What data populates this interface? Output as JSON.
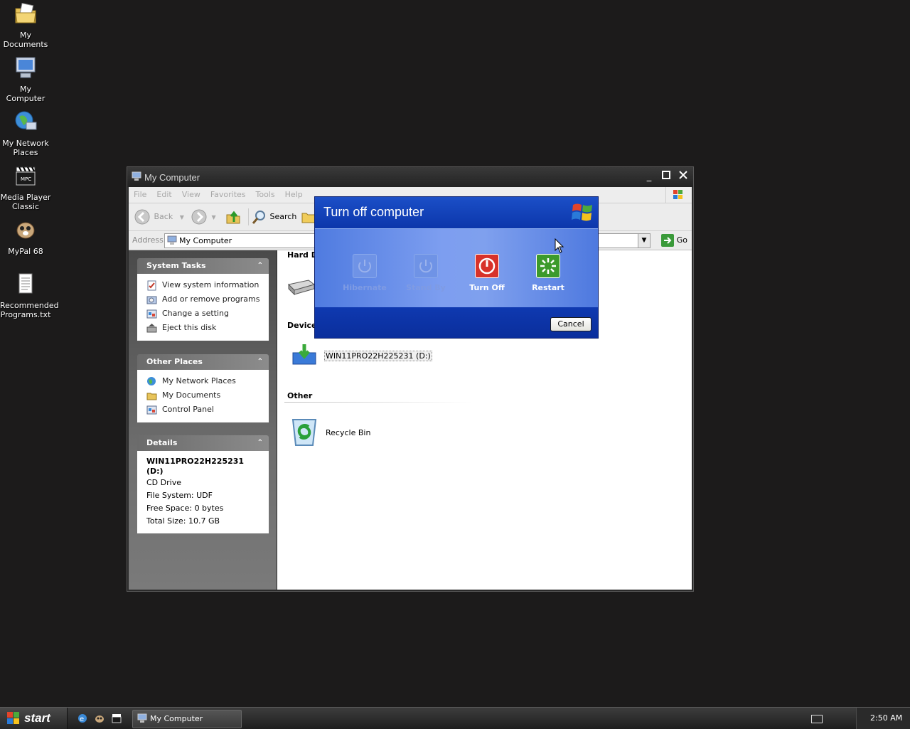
{
  "desktop": {
    "icons": [
      {
        "label": "My Documents",
        "icon": "folder-documents-icon"
      },
      {
        "label": "My Computer",
        "icon": "computer-icon"
      },
      {
        "label": "My Network Places",
        "icon": "network-icon"
      },
      {
        "label": "Media Player Classic",
        "icon": "clapperboard-icon"
      },
      {
        "label": "MyPal 68",
        "icon": "mypal-icon"
      },
      {
        "label": "Recommended Programs.txt",
        "icon": "text-file-icon"
      }
    ]
  },
  "window": {
    "title": "My Computer",
    "menu": [
      "File",
      "Edit",
      "View",
      "Favorites",
      "Tools",
      "Help"
    ],
    "toolbar": {
      "back": "Back",
      "search": "Search"
    },
    "address": {
      "label": "Address",
      "value": "My Computer",
      "go": "Go"
    },
    "system_tasks": {
      "title": "System Tasks",
      "items": [
        "View system information",
        "Add or remove programs",
        "Change a setting",
        "Eject this disk"
      ]
    },
    "other_places": {
      "title": "Other Places",
      "items": [
        "My Network Places",
        "My Documents",
        "Control Panel"
      ]
    },
    "details": {
      "title": "Details",
      "name": "WIN11PRO22H225231 (D:)",
      "type": "CD Drive",
      "file_system": "File System: UDF",
      "free_space": "Free Space: 0 bytes",
      "total_size": "Total Size: 10.7 GB"
    },
    "content": {
      "hard_disks_header": "Hard D",
      "devices_header": "Device",
      "drive_label": "WIN11PRO22H225231 (D:)",
      "other_header": "Other",
      "recycle_bin": "Recycle Bin"
    }
  },
  "dialog": {
    "title": "Turn off computer",
    "options": [
      {
        "label": "Hibernate",
        "enabled": false
      },
      {
        "label": "Stand By",
        "enabled": false
      },
      {
        "label": "Turn Off",
        "enabled": true,
        "color": "#d8322a"
      },
      {
        "label": "Restart",
        "enabled": true,
        "color": "#3c9a2b"
      }
    ],
    "cancel": "Cancel"
  },
  "taskbar": {
    "start": "start",
    "window_button": "My Computer",
    "clock": "2:50 AM"
  }
}
